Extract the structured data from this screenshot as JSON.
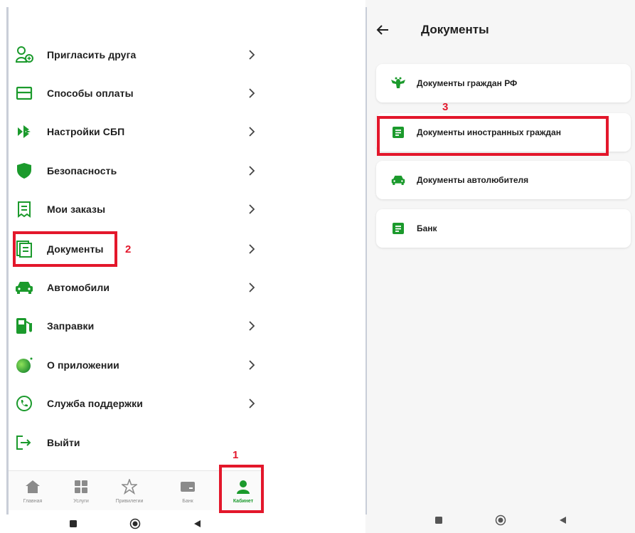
{
  "left": {
    "menu": [
      {
        "label": "Пригласить друга",
        "icon": "invite-friend-icon"
      },
      {
        "label": "Способы оплаты",
        "icon": "payment-card-icon"
      },
      {
        "label": "Настройки СБП",
        "icon": "sbp-icon"
      },
      {
        "label": "Безопасность",
        "icon": "shield-icon"
      },
      {
        "label": "Мои заказы",
        "icon": "receipt-icon"
      },
      {
        "label": "Документы",
        "icon": "documents-icon"
      },
      {
        "label": "Автомобили",
        "icon": "car-icon"
      },
      {
        "label": "Заправки",
        "icon": "fuel-pump-icon"
      },
      {
        "label": "О приложении",
        "icon": "app-logo-icon"
      },
      {
        "label": "Служба поддержки",
        "icon": "phone-icon"
      },
      {
        "label": "Выйти",
        "icon": "logout-icon"
      }
    ],
    "bottom_nav": [
      {
        "label": "Главная",
        "icon": "home-icon"
      },
      {
        "label": "Услуги",
        "icon": "grid-icon"
      },
      {
        "label": "Привилегии",
        "icon": "star-icon"
      },
      {
        "label": "Банк",
        "icon": "bank-card-icon"
      },
      {
        "label": "Кабинет",
        "icon": "profile-icon",
        "active": true
      }
    ],
    "annotations": {
      "step1": "1",
      "step2": "2"
    }
  },
  "right": {
    "title": "Документы",
    "cards": [
      {
        "label": "Документы граждан РФ",
        "icon": "coat-of-arms-icon"
      },
      {
        "label": "Документы иностранных граждан",
        "icon": "document-icon"
      },
      {
        "label": "Документы автолюбителя",
        "icon": "car-icon"
      },
      {
        "label": "Банк",
        "icon": "document-icon"
      }
    ],
    "annotations": {
      "step3": "3"
    }
  },
  "colors": {
    "accent": "#1b9a2c",
    "annotation": "#e3172b",
    "text": "#1e1e1e"
  }
}
